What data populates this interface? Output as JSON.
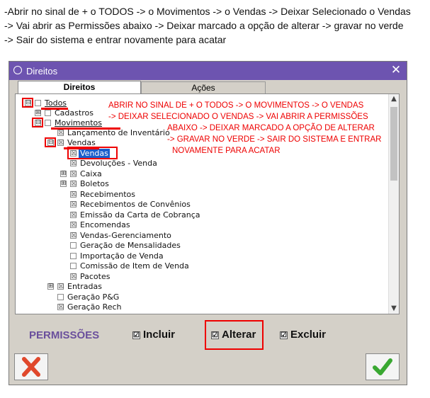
{
  "instructions": {
    "line1": "-Abrir no sinal de + o TODOS -> o Movimentos -> o Vendas -> Deixar Selecionado o Vendas",
    "line2": "-> Vai abrir as Permissões abaixo -> Deixar marcado a opção de alterar -> gravar no verde",
    "line3": "-> Sair do sistema e entrar novamente para acatar"
  },
  "window": {
    "title": "Direitos",
    "close_icon": "close-icon"
  },
  "tabs": [
    {
      "label": "Direitos",
      "active": true
    },
    {
      "label": "Ações",
      "active": false
    }
  ],
  "tree": {
    "items": [
      {
        "label": "Todos",
        "expander": "⊟",
        "checkbox": ""
      },
      {
        "label": "Cadastros",
        "expander": "⊞",
        "checkbox": ""
      },
      {
        "label": "Movimentos",
        "expander": "⊟",
        "checkbox": ""
      },
      {
        "label": "Lançamento de Inventário",
        "expander": "",
        "checkbox": "☒"
      },
      {
        "label": "Vendas",
        "expander": "⊟",
        "checkbox": "☒"
      },
      {
        "label": "Vendas",
        "expander": "",
        "checkbox": "☒",
        "selected": true
      },
      {
        "label": "Devoluções - Venda",
        "expander": "",
        "checkbox": "☒"
      },
      {
        "label": "Caixa",
        "expander": "⊞",
        "checkbox": "☒"
      },
      {
        "label": "Boletos",
        "expander": "⊞",
        "checkbox": "☒"
      },
      {
        "label": "Recebimentos",
        "expander": "",
        "checkbox": "☒"
      },
      {
        "label": "Recebimentos de Convênios",
        "expander": "",
        "checkbox": "☒"
      },
      {
        "label": "Emissão da Carta de Cobrança",
        "expander": "",
        "checkbox": "☒"
      },
      {
        "label": "Encomendas",
        "expander": "",
        "checkbox": "☒"
      },
      {
        "label": "Vendas-Gerenciamento",
        "expander": "",
        "checkbox": "☒"
      },
      {
        "label": "Geração de Mensalidades",
        "expander": "",
        "checkbox": ""
      },
      {
        "label": "Importação de Venda",
        "expander": "",
        "checkbox": ""
      },
      {
        "label": "Comissão de Item de Venda",
        "expander": "",
        "checkbox": ""
      },
      {
        "label": "Pacotes",
        "expander": "",
        "checkbox": "☒"
      },
      {
        "label": "Entradas",
        "expander": "⊞",
        "checkbox": "☒"
      },
      {
        "label": "Geração P&G",
        "expander": "",
        "checkbox": ""
      },
      {
        "label": "Geração Rech",
        "expander": "",
        "checkbox": "☒"
      }
    ]
  },
  "annotation": {
    "line1": "ABRIR NO SINAL DE + O TODOS -> O MOVIMENTOS -> O VENDAS",
    "line2": "-> DEIXAR SELECIONADO O VENDAS -> VAI ABRIR A PERMISSÕES",
    "line3": "ABAIXO -> DEIXAR MARCADO A OPÇÃO DE ALTERAR",
    "line4": "-> GRAVAR NO VERDE -> SAIR DO SISTEMA E ENTRAR",
    "line5": "NOVAMENTE PARA ACATAR",
    "color": "#e00000"
  },
  "permissions": {
    "label": "PERMISSÕES",
    "incluir": {
      "label": "Incluir",
      "checked": true,
      "mark": "☑"
    },
    "alterar": {
      "label": "Alterar",
      "checked": true,
      "mark": "☑"
    },
    "excluir": {
      "label": "Excluir",
      "checked": true,
      "mark": "☑"
    }
  },
  "buttons": {
    "cancel_icon": "x-cancel-icon",
    "ok_icon": "check-confirm-icon"
  },
  "colors": {
    "titlebar": "#6d54b0",
    "selection": "#1a5fcc",
    "permissions_label": "#6a4f9c",
    "cancel": "#e0482c",
    "ok": "#3aa832",
    "annotation": "#e00000"
  }
}
